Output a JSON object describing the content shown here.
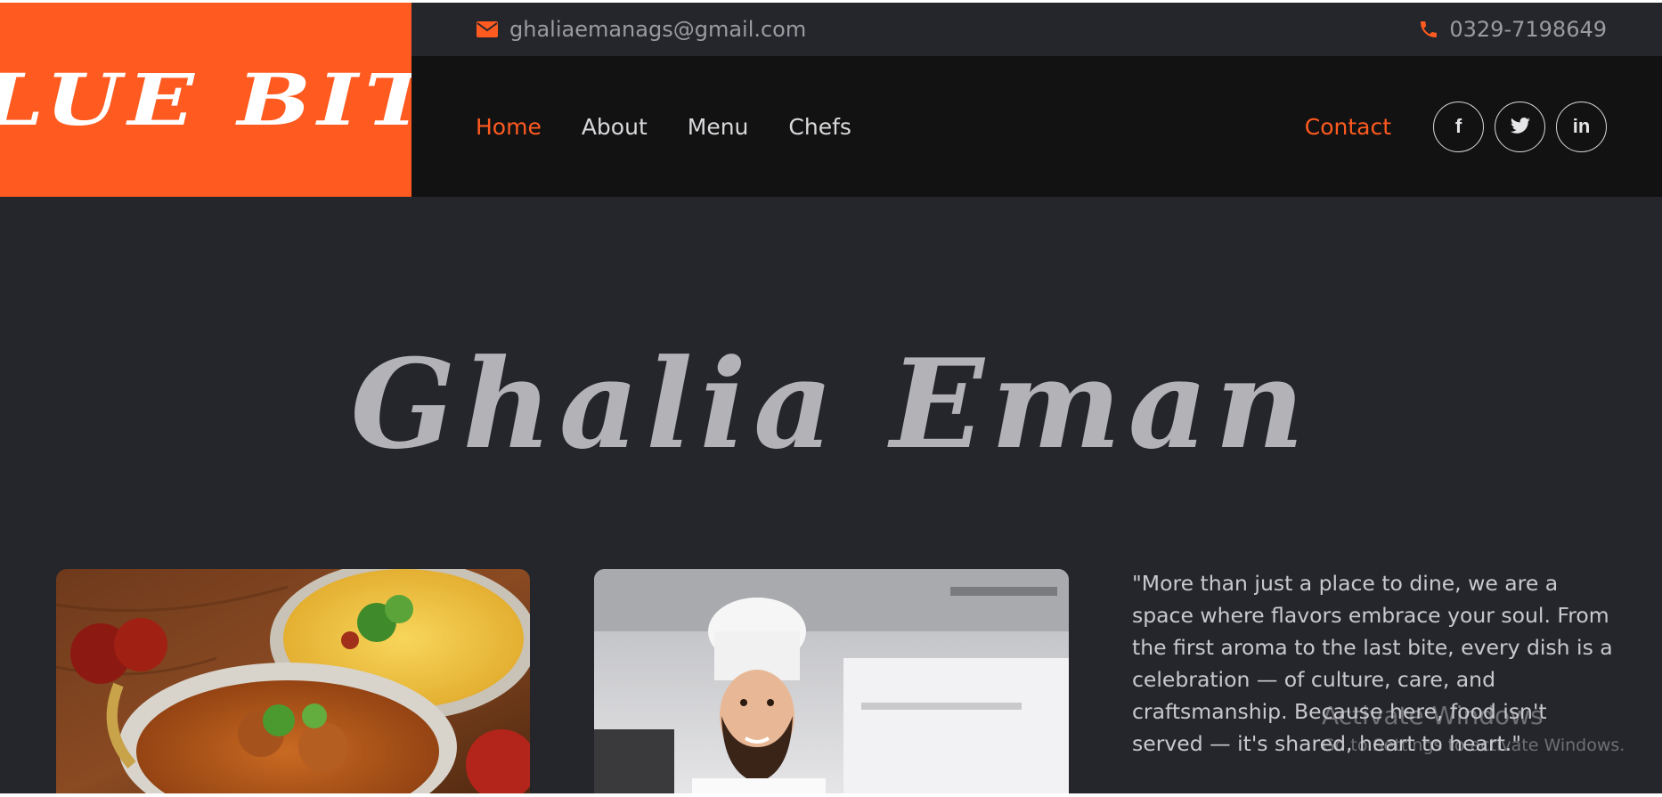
{
  "brand": {
    "logo_text": "BLUE BITE",
    "accent_color": "#ff5a1f"
  },
  "contact_bar": {
    "email": "ghaliaemanags@gmail.com",
    "email_icon": "envelope-icon",
    "phone": "0329-7198649",
    "phone_icon": "phone-icon"
  },
  "nav": {
    "items": [
      {
        "label": "Home",
        "active": true
      },
      {
        "label": "About",
        "active": false
      },
      {
        "label": "Menu",
        "active": false
      },
      {
        "label": "Chefs",
        "active": false
      }
    ],
    "contact_label": "Contact",
    "social": [
      {
        "icon": "facebook-icon",
        "glyph": "f"
      },
      {
        "icon": "twitter-icon",
        "glyph": ""
      },
      {
        "icon": "linkedin-icon",
        "glyph": "in"
      }
    ]
  },
  "hero": {
    "title": "Ghalia Eman",
    "quote": "\"More than just a place to dine, we are a space where flavors embrace your soul. From the first aroma to the last bite, every dish is a celebration — of culture, care, and craftsmanship. Because here, food isn't served — it's shared, heart to heart.\""
  },
  "images": [
    {
      "name": "food-image",
      "alt": "Biryani and curry dishes"
    },
    {
      "name": "chef-image",
      "alt": "Smiling chef in white hat"
    }
  ],
  "os_watermark": {
    "title": "Activate Windows",
    "subtitle": "Go to Settings to activate Windows."
  }
}
